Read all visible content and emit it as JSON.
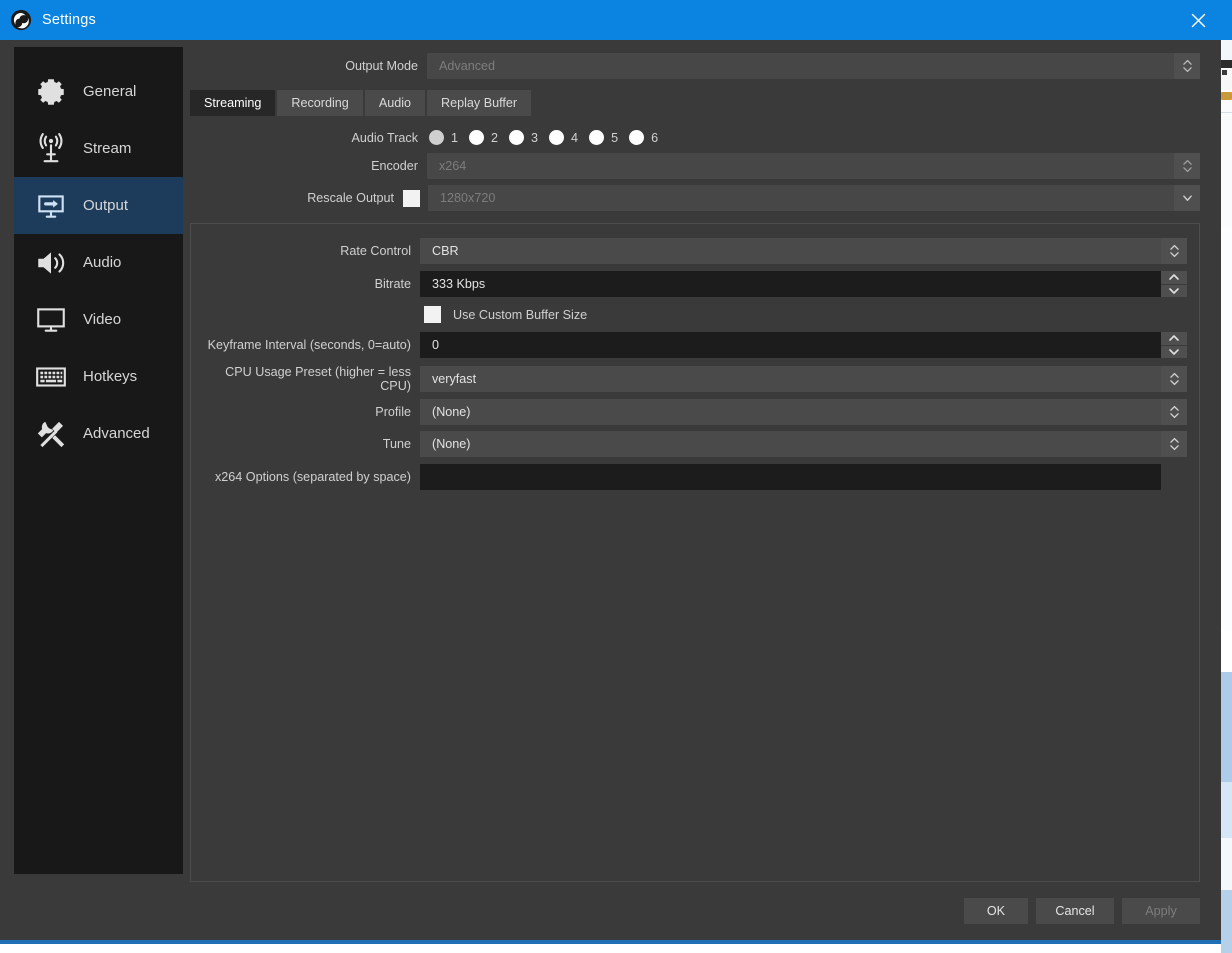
{
  "window": {
    "title": "Settings",
    "logo_icon": "obs-logo-icon",
    "close_icon": "close-icon",
    "titlebar_color": "#0a84e0",
    "accent_color": "#1d3c5c"
  },
  "sidebar": {
    "items": [
      {
        "label": "General",
        "icon": "gear-icon",
        "selected": false
      },
      {
        "label": "Stream",
        "icon": "broadcast-icon",
        "selected": false
      },
      {
        "label": "Output",
        "icon": "output-icon",
        "selected": true
      },
      {
        "label": "Audio",
        "icon": "speaker-icon",
        "selected": false
      },
      {
        "label": "Video",
        "icon": "monitor-icon",
        "selected": false
      },
      {
        "label": "Hotkeys",
        "icon": "keyboard-icon",
        "selected": false
      },
      {
        "label": "Advanced",
        "icon": "tools-icon",
        "selected": false
      }
    ]
  },
  "output_mode": {
    "label": "Output Mode",
    "value": "Advanced",
    "disabled": true,
    "arrow_icon": "chevron-updown-icon"
  },
  "tabs": [
    {
      "label": "Streaming",
      "active": true
    },
    {
      "label": "Recording",
      "active": false
    },
    {
      "label": "Audio",
      "active": false
    },
    {
      "label": "Replay Buffer",
      "active": false
    }
  ],
  "audio_track": {
    "label": "Audio Track",
    "options": [
      "1",
      "2",
      "3",
      "4",
      "5",
      "6"
    ],
    "selected": "1"
  },
  "encoder": {
    "label": "Encoder",
    "value": "x264",
    "disabled": true,
    "arrow_icon": "chevron-updown-icon"
  },
  "rescale_output": {
    "label": "Rescale Output",
    "checked": false,
    "value": "1280x720",
    "disabled": true,
    "arrow_icon": "chevron-down-icon"
  },
  "encoder_settings": {
    "rate_control": {
      "label": "Rate Control",
      "value": "CBR",
      "arrow_icon": "chevron-updown-icon"
    },
    "bitrate": {
      "label": "Bitrate",
      "value": "333 Kbps",
      "up_icon": "chevron-up-icon",
      "down_icon": "chevron-down-icon"
    },
    "use_custom_buffer_size": {
      "label": "Use Custom Buffer Size",
      "checked": false
    },
    "keyframe_interval": {
      "label": "Keyframe Interval (seconds, 0=auto)",
      "value": "0",
      "up_icon": "chevron-up-icon",
      "down_icon": "chevron-down-icon"
    },
    "cpu_usage_preset": {
      "label": "CPU Usage Preset (higher = less CPU)",
      "value": "veryfast",
      "arrow_icon": "chevron-updown-icon"
    },
    "profile": {
      "label": "Profile",
      "value": "(None)",
      "arrow_icon": "chevron-updown-icon"
    },
    "tune": {
      "label": "Tune",
      "value": "(None)",
      "arrow_icon": "chevron-updown-icon"
    },
    "x264_options": {
      "label": "x264 Options (separated by space)",
      "value": "",
      "placeholder": ""
    }
  },
  "footer": {
    "ok": "OK",
    "cancel": "Cancel",
    "apply": "Apply",
    "apply_disabled": true
  }
}
